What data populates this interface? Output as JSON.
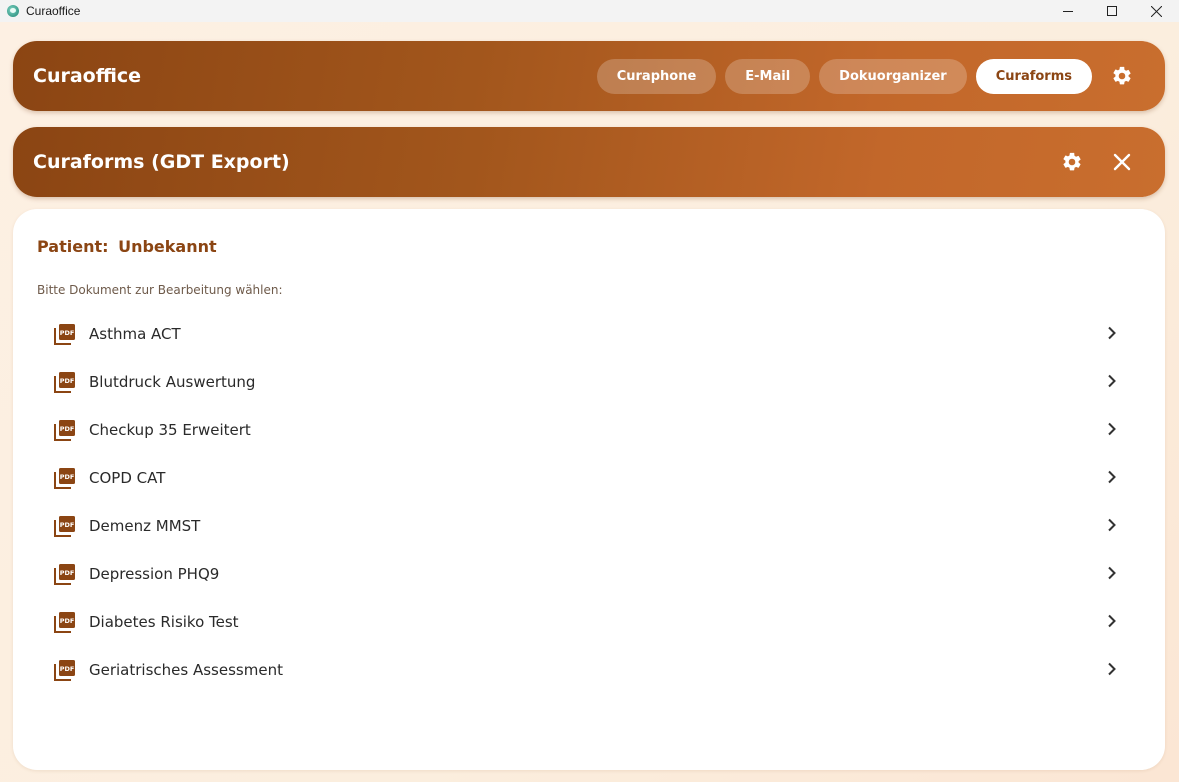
{
  "window": {
    "title": "Curaoffice",
    "controls": {
      "minimize_icon": "minimize-icon",
      "maximize_icon": "maximize-icon",
      "close_icon": "close-icon"
    }
  },
  "header": {
    "title": "Curaoffice",
    "nav": [
      {
        "label": "Curaphone",
        "active": false
      },
      {
        "label": "E-Mail",
        "active": false
      },
      {
        "label": "Dokuorganizer",
        "active": false
      },
      {
        "label": "Curaforms",
        "active": true
      }
    ],
    "settings_icon": "gear-icon"
  },
  "subheader": {
    "title": "Curaforms (GDT Export)",
    "settings_icon": "gear-icon",
    "close_icon": "close-icon"
  },
  "main": {
    "patient_label": "Patient:",
    "patient_value": "Unbekannt",
    "hint": "Bitte Dokument zur Bearbeitung wählen:",
    "documents": [
      {
        "label": "Asthma ACT",
        "icon": "pdf-icon"
      },
      {
        "label": "Blutdruck Auswertung",
        "icon": "pdf-icon"
      },
      {
        "label": "Checkup 35 Erweitert",
        "icon": "pdf-icon"
      },
      {
        "label": "COPD CAT",
        "icon": "pdf-icon"
      },
      {
        "label": "Demenz MMST",
        "icon": "pdf-icon"
      },
      {
        "label": "Depression PHQ9",
        "icon": "pdf-icon"
      },
      {
        "label": "Diabetes Risiko Test",
        "icon": "pdf-icon"
      },
      {
        "label": "Geriatrisches Assessment",
        "icon": "pdf-icon"
      }
    ]
  },
  "colors": {
    "brand_dark": "#8b4513",
    "brand_light": "#c96e2e",
    "background": "#fdf0e3",
    "text": "#2a2a2a"
  }
}
